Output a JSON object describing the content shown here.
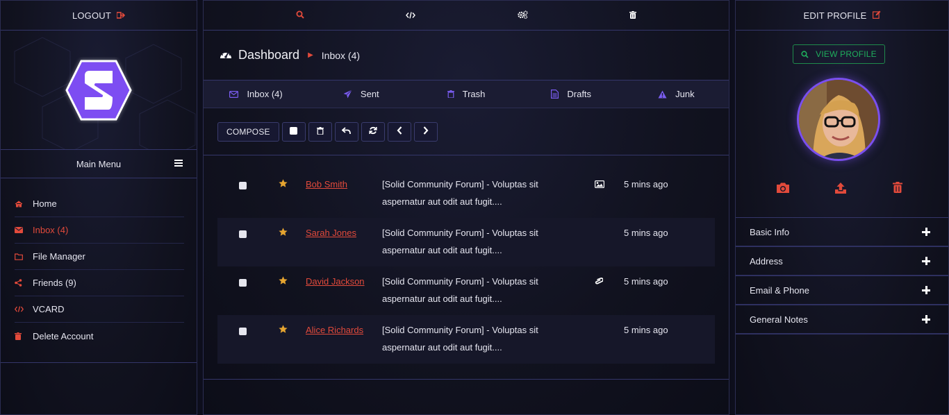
{
  "colors": {
    "accent_red": "#e24a3b",
    "accent_purple": "#7a5cf0",
    "star": "#e5a430",
    "green": "#1fae5c"
  },
  "left": {
    "logout_label": "LOGOUT",
    "logo_letter": "S",
    "main_menu_label": "Main Menu",
    "menu": [
      {
        "label": "Home",
        "icon": "home-icon"
      },
      {
        "label": "Inbox (4)",
        "icon": "envelope-icon",
        "active": true
      },
      {
        "label": "File Manager",
        "icon": "folder-icon"
      },
      {
        "label": "Friends (9)",
        "icon": "share-icon"
      },
      {
        "label": "VCARD",
        "icon": "code-icon"
      },
      {
        "label": "Delete Account",
        "icon": "trash-icon"
      }
    ]
  },
  "center": {
    "top_icons": [
      "search-icon",
      "code-icon",
      "gears-icon",
      "trash-icon"
    ],
    "title": "Dashboard",
    "breadcrumb": "Inbox (4)",
    "tabs": [
      {
        "label": "Inbox (4)",
        "icon": "envelope-icon"
      },
      {
        "label": "Sent",
        "icon": "paper-plane-icon"
      },
      {
        "label": "Trash",
        "icon": "trash-icon"
      },
      {
        "label": "Drafts",
        "icon": "file-icon"
      },
      {
        "label": "Junk",
        "icon": "warning-icon"
      }
    ],
    "toolbar": {
      "compose_label": "COMPOSE"
    },
    "mails": [
      {
        "sender": "Bob Smith",
        "subject_line1": "[Solid Community Forum] - Voluptas sit",
        "subject_line2": "aspernatur aut odit aut fugit....",
        "attachment": "image-icon",
        "time": "5 mins ago"
      },
      {
        "sender": "Sarah Jones",
        "subject_line1": "[Solid Community Forum] - Voluptas sit",
        "subject_line2": "aspernatur aut odit aut fugit....",
        "attachment": "",
        "time": "5 mins ago"
      },
      {
        "sender": "David Jackson",
        "subject_line1": "[Solid Community Forum] - Voluptas sit",
        "subject_line2": "aspernatur aut odit aut fugit....",
        "attachment": "paperclip-icon",
        "time": "5 mins ago"
      },
      {
        "sender": "Alice Richards",
        "subject_line1": "[Solid Community Forum] - Voluptas sit",
        "subject_line2": "aspernatur aut odit aut fugit....",
        "attachment": "",
        "time": "5 mins ago"
      }
    ]
  },
  "right": {
    "edit_profile_label": "EDIT PROFILE",
    "view_profile_label": "VIEW PROFILE",
    "sections": [
      "Basic Info",
      "Address",
      "Email & Phone",
      "General Notes"
    ]
  }
}
